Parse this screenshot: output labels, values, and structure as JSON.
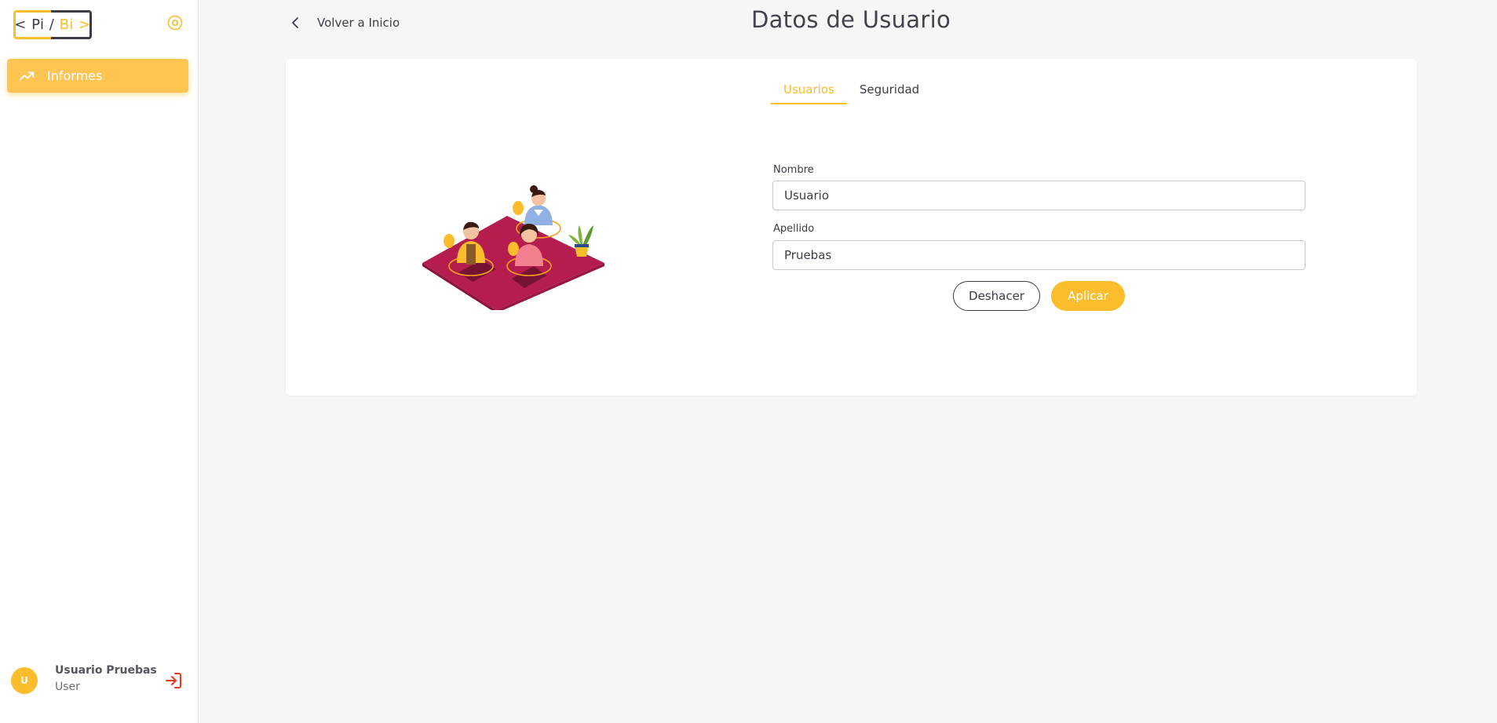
{
  "sidebar": {
    "logo": {
      "left_text": "< Pi /",
      "right_text": "Bi >"
    },
    "nav": [
      {
        "label": "Informes",
        "icon": "trending-up-icon"
      }
    ],
    "user": {
      "initial": "U",
      "name": "Usuario Pruebas",
      "role": "User"
    }
  },
  "header": {
    "back_label": "Volver a Inicio",
    "title": "Datos de Usuario"
  },
  "tabs": [
    {
      "label": "Usuarios",
      "active": true
    },
    {
      "label": "Seguridad",
      "active": false
    }
  ],
  "form": {
    "nombre": {
      "label": "Nombre",
      "value": "Usuario"
    },
    "apellido": {
      "label": "Apellido",
      "value": "Pruebas"
    },
    "undo_label": "Deshacer",
    "apply_label": "Aplicar"
  },
  "colors": {
    "accent": "#fbbd2b",
    "text": "#3c3c46",
    "background": "#f6f6f6",
    "logout": "#e8381a"
  }
}
